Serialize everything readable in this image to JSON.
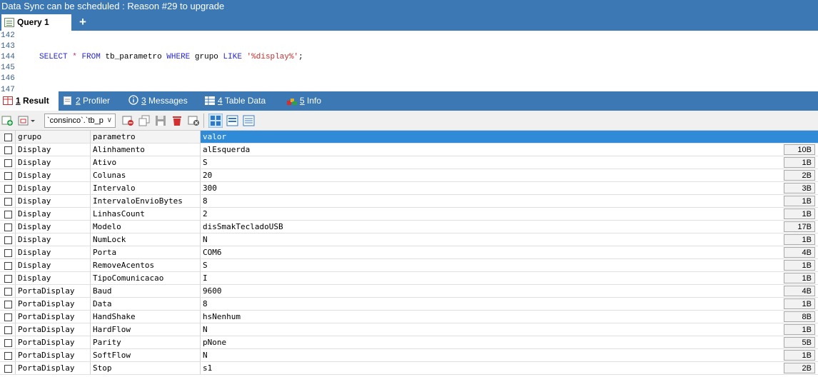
{
  "banner": {
    "text": "Data Sync can be scheduled : Reason #29 to upgrade"
  },
  "query_tabs": {
    "active_label": "Query 1",
    "add_label": "+"
  },
  "editor": {
    "line_numbers": [
      "142",
      "143",
      "144",
      "145",
      "146",
      "147"
    ],
    "sql": {
      "select": "SELECT",
      "star": "*",
      "from": "FROM",
      "table": "tb_parametro",
      "where": "WHERE",
      "column": "grupo",
      "like": "LIKE",
      "pattern": "'%display%'",
      "end": ";"
    }
  },
  "result_tabs": [
    {
      "num": "1",
      "label": "Result",
      "icon": "result-grid-icon"
    },
    {
      "num": "2",
      "label": "Profiler",
      "icon": "profiler-icon"
    },
    {
      "num": "3",
      "label": "Messages",
      "icon": "info-icon"
    },
    {
      "num": "4",
      "label": "Table Data",
      "icon": "table-icon"
    },
    {
      "num": "5",
      "label": "Info",
      "icon": "info-blocks-icon"
    }
  ],
  "toolbar": {
    "table_combo": "`consinco`.`tb_p"
  },
  "grid": {
    "columns": [
      "grupo",
      "parametro",
      "valor"
    ],
    "rows": [
      {
        "grupo": "Display",
        "parametro": "Alinhamento",
        "valor": "alEsquerda",
        "size": "10B"
      },
      {
        "grupo": "Display",
        "parametro": "Ativo",
        "valor": "S",
        "size": "1B"
      },
      {
        "grupo": "Display",
        "parametro": "Colunas",
        "valor": "20",
        "size": "2B"
      },
      {
        "grupo": "Display",
        "parametro": "Intervalo",
        "valor": "300",
        "size": "3B"
      },
      {
        "grupo": "Display",
        "parametro": "IntervaloEnvioBytes",
        "valor": "8",
        "size": "1B"
      },
      {
        "grupo": "Display",
        "parametro": "LinhasCount",
        "valor": "2",
        "size": "1B"
      },
      {
        "grupo": "Display",
        "parametro": "Modelo",
        "valor": "disSmakTecladoUSB",
        "size": "17B"
      },
      {
        "grupo": "Display",
        "parametro": "NumLock",
        "valor": "N",
        "size": "1B"
      },
      {
        "grupo": "Display",
        "parametro": "Porta",
        "valor": "COM6",
        "size": "4B"
      },
      {
        "grupo": "Display",
        "parametro": "RemoveAcentos",
        "valor": "S",
        "size": "1B"
      },
      {
        "grupo": "Display",
        "parametro": "TipoComunicacao",
        "valor": "I",
        "size": "1B"
      },
      {
        "grupo": "PortaDisplay",
        "parametro": "Baud",
        "valor": "9600",
        "size": "4B"
      },
      {
        "grupo": "PortaDisplay",
        "parametro": "Data",
        "valor": "8",
        "size": "1B"
      },
      {
        "grupo": "PortaDisplay",
        "parametro": "HandShake",
        "valor": "hsNenhum",
        "size": "8B"
      },
      {
        "grupo": "PortaDisplay",
        "parametro": "HardFlow",
        "valor": "N",
        "size": "1B"
      },
      {
        "grupo": "PortaDisplay",
        "parametro": "Parity",
        "valor": "pNone",
        "size": "5B"
      },
      {
        "grupo": "PortaDisplay",
        "parametro": "SoftFlow",
        "valor": "N",
        "size": "1B"
      },
      {
        "grupo": "PortaDisplay",
        "parametro": "Stop",
        "valor": "s1",
        "size": "2B"
      }
    ]
  }
}
